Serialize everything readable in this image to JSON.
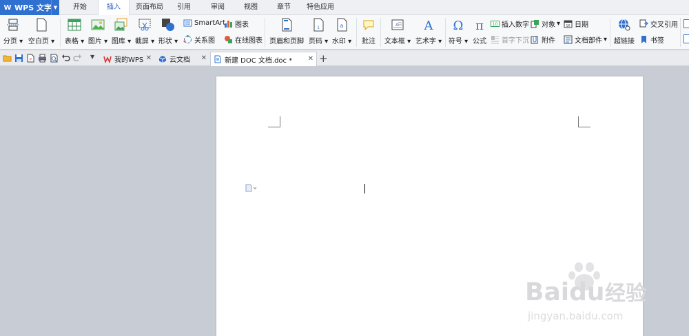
{
  "app": {
    "name": "WPS 文字",
    "brand_color": "#2f70d0"
  },
  "menu": {
    "tabs": [
      "开始",
      "插入",
      "页面布局",
      "引用",
      "审阅",
      "视图",
      "章节",
      "特色应用"
    ],
    "active": "插入"
  },
  "ribbon": {
    "page_break": "分页",
    "blank_page": "空白页",
    "table": "表格",
    "picture": "图片",
    "gallery": "图库",
    "screenshot": "截屏",
    "shapes": "形状",
    "smartart": "SmartArt",
    "chart": "图表",
    "relation_chart": "关系图",
    "online_chart": "在线图表",
    "header_footer": "页眉和页脚",
    "page_number": "页码",
    "watermark": "水印",
    "comment": "批注",
    "textbox": "文本框",
    "wordart": "艺术字",
    "symbol": "符号",
    "formula": "公式",
    "insert_number": "插入数字",
    "object": "对象",
    "date": "日期",
    "drop_cap": "首字下沉",
    "attachment": "附件",
    "doc_parts": "文档部件",
    "hyperlink": "超链接",
    "cross_ref": "交叉引用",
    "bookmark": "书签"
  },
  "doc_tabs": {
    "my_wps": "我的WPS",
    "cloud_docs": "云文档",
    "current_doc": "新建 DOC 文档.doc *"
  },
  "watermark": {
    "brand": "Baidu",
    "suffix": "经验",
    "url": "jingyan.baidu.com"
  }
}
